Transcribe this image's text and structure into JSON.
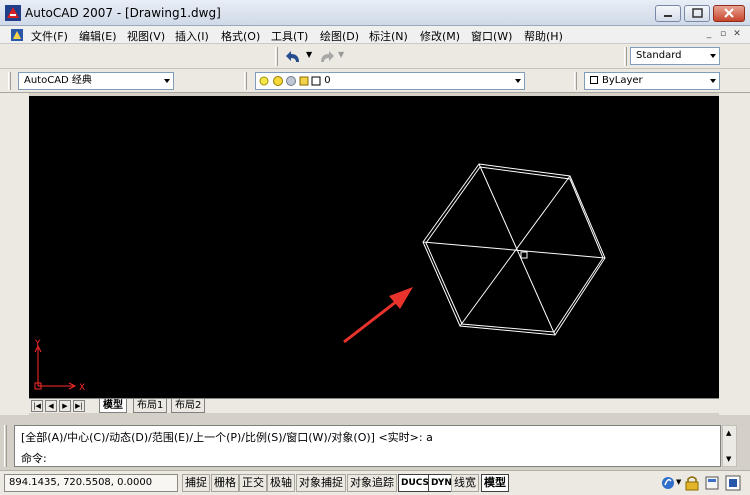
{
  "window": {
    "title": "AutoCAD 2007 - [Drawing1.dwg]"
  },
  "menu": {
    "items": [
      "文件(F)",
      "编辑(E)",
      "视图(V)",
      "插入(I)",
      "格式(O)",
      "工具(T)",
      "绘图(D)",
      "标注(N)",
      "修改(M)",
      "窗口(W)",
      "帮助(H)"
    ]
  },
  "toolbar": {
    "text_style": "Standard",
    "workspace": "AutoCAD 经典",
    "layer": "0",
    "color": "ByLayer"
  },
  "layout_tabs": {
    "items": [
      "模型",
      "布局1",
      "布局2"
    ],
    "active": "模型"
  },
  "command": {
    "line1": "[全部(A)/中心(C)/动态(D)/范围(E)/上一个(P)/比例(S)/窗口(W)/对象(O)] <实时>: a",
    "prompt": "命令:"
  },
  "status": {
    "coords": "894.1435, 720.5508, 0.0000",
    "buttons": [
      "捕捉",
      "栅格",
      "正交",
      "极轴",
      "对象捕捉",
      "对象追踪",
      "DUCS",
      "DYN",
      "线宽",
      "模型"
    ]
  },
  "ucs": {
    "x_label": "X",
    "y_label": "Y"
  },
  "colors": {
    "drawing_bg": "#000000",
    "linework": "#ffffff",
    "annotation_arrow": "#e8322c",
    "ucs_icon": "#ff2a2a"
  }
}
